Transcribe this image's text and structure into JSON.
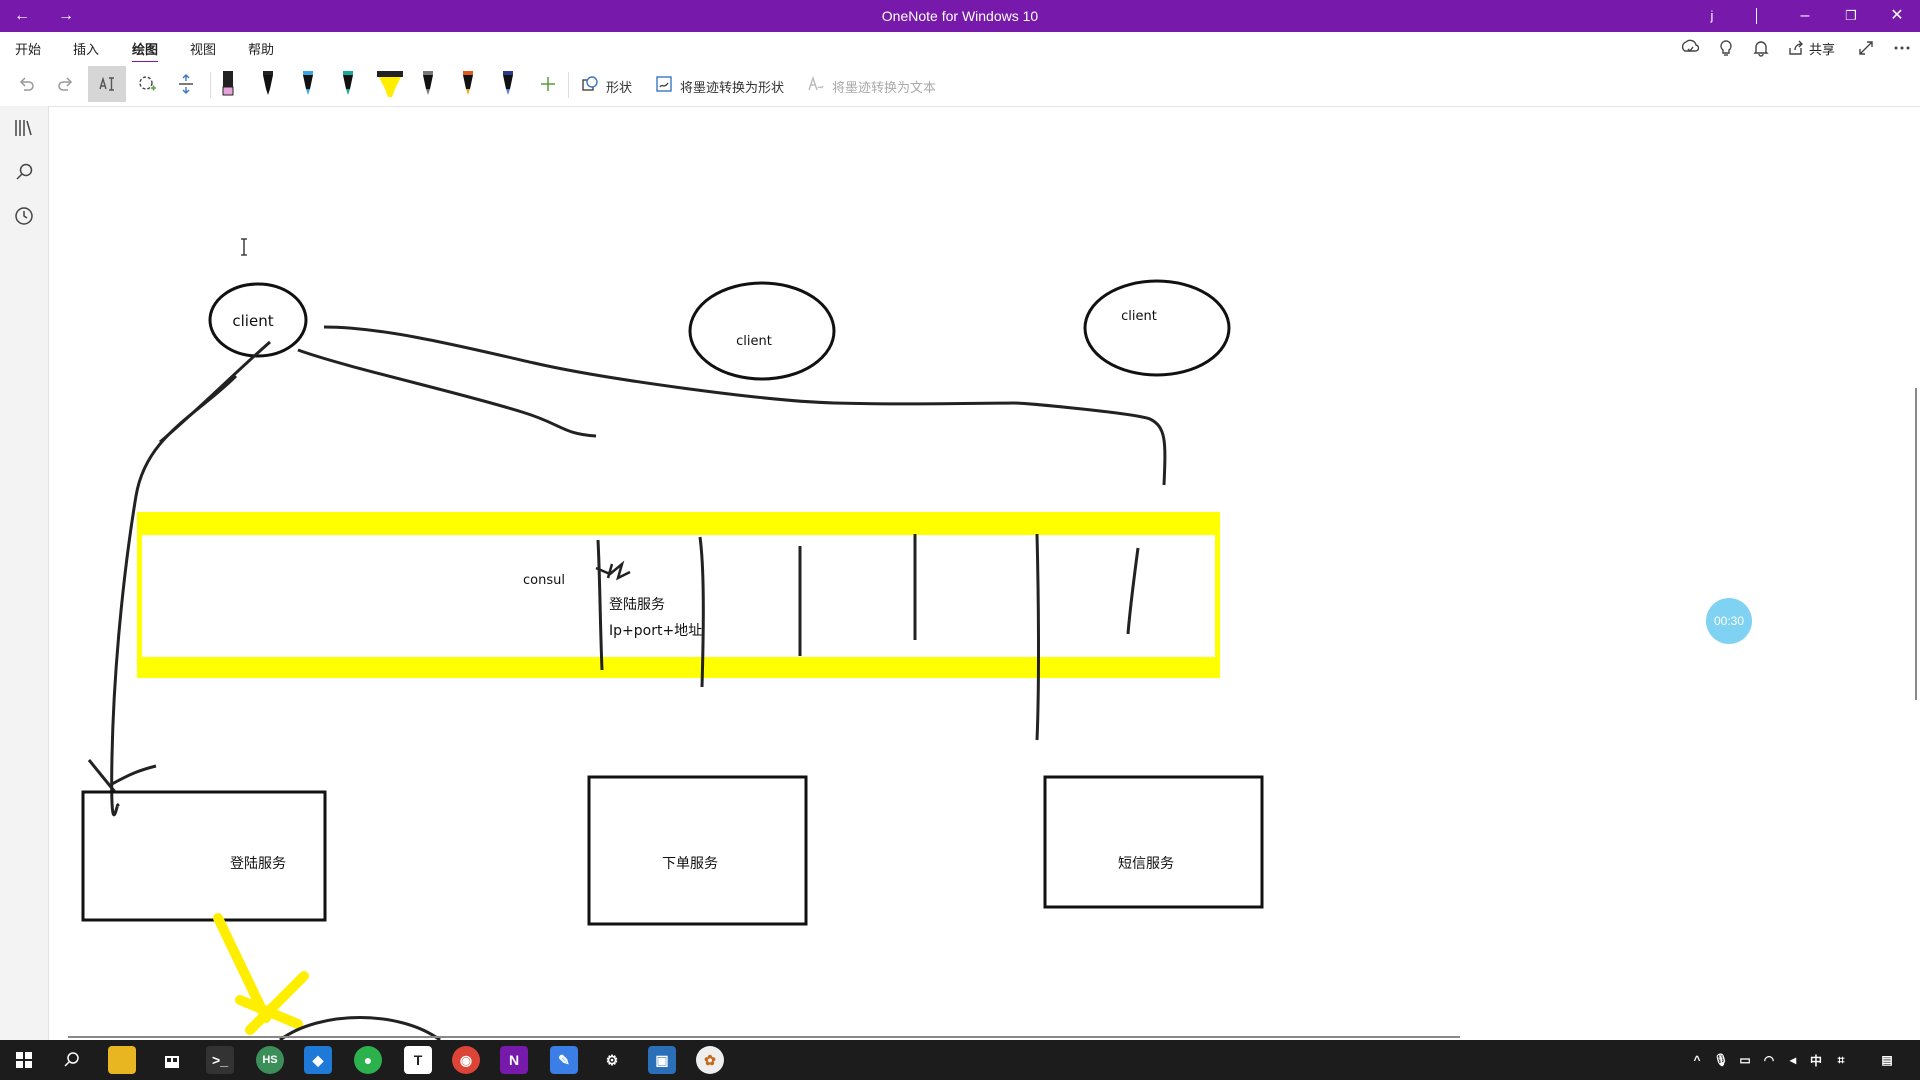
{
  "window": {
    "title": "OneNote for Windows 10",
    "user_initial": "j"
  },
  "menu": [
    "开始",
    "插入",
    "绘图",
    "视图",
    "帮助"
  ],
  "toolbar": {
    "shapes_label": "形状",
    "ink_to_shape_label": "将墨迹转换为形状",
    "ink_to_text_label": "将墨迹转换为文本",
    "share_label": "共享"
  },
  "canvas": {
    "client_labels": [
      "client",
      "client",
      "client"
    ],
    "consul_label": "consul",
    "register_label": "登陆服务",
    "register_note": "Ip+port+地址",
    "services": [
      "登陆服务",
      "下单服务",
      "短信服务"
    ]
  },
  "timer": "00:30",
  "colors": {
    "brand": "#7719aa",
    "highlight": "#ffff00",
    "timer": "#7fd2f2"
  }
}
